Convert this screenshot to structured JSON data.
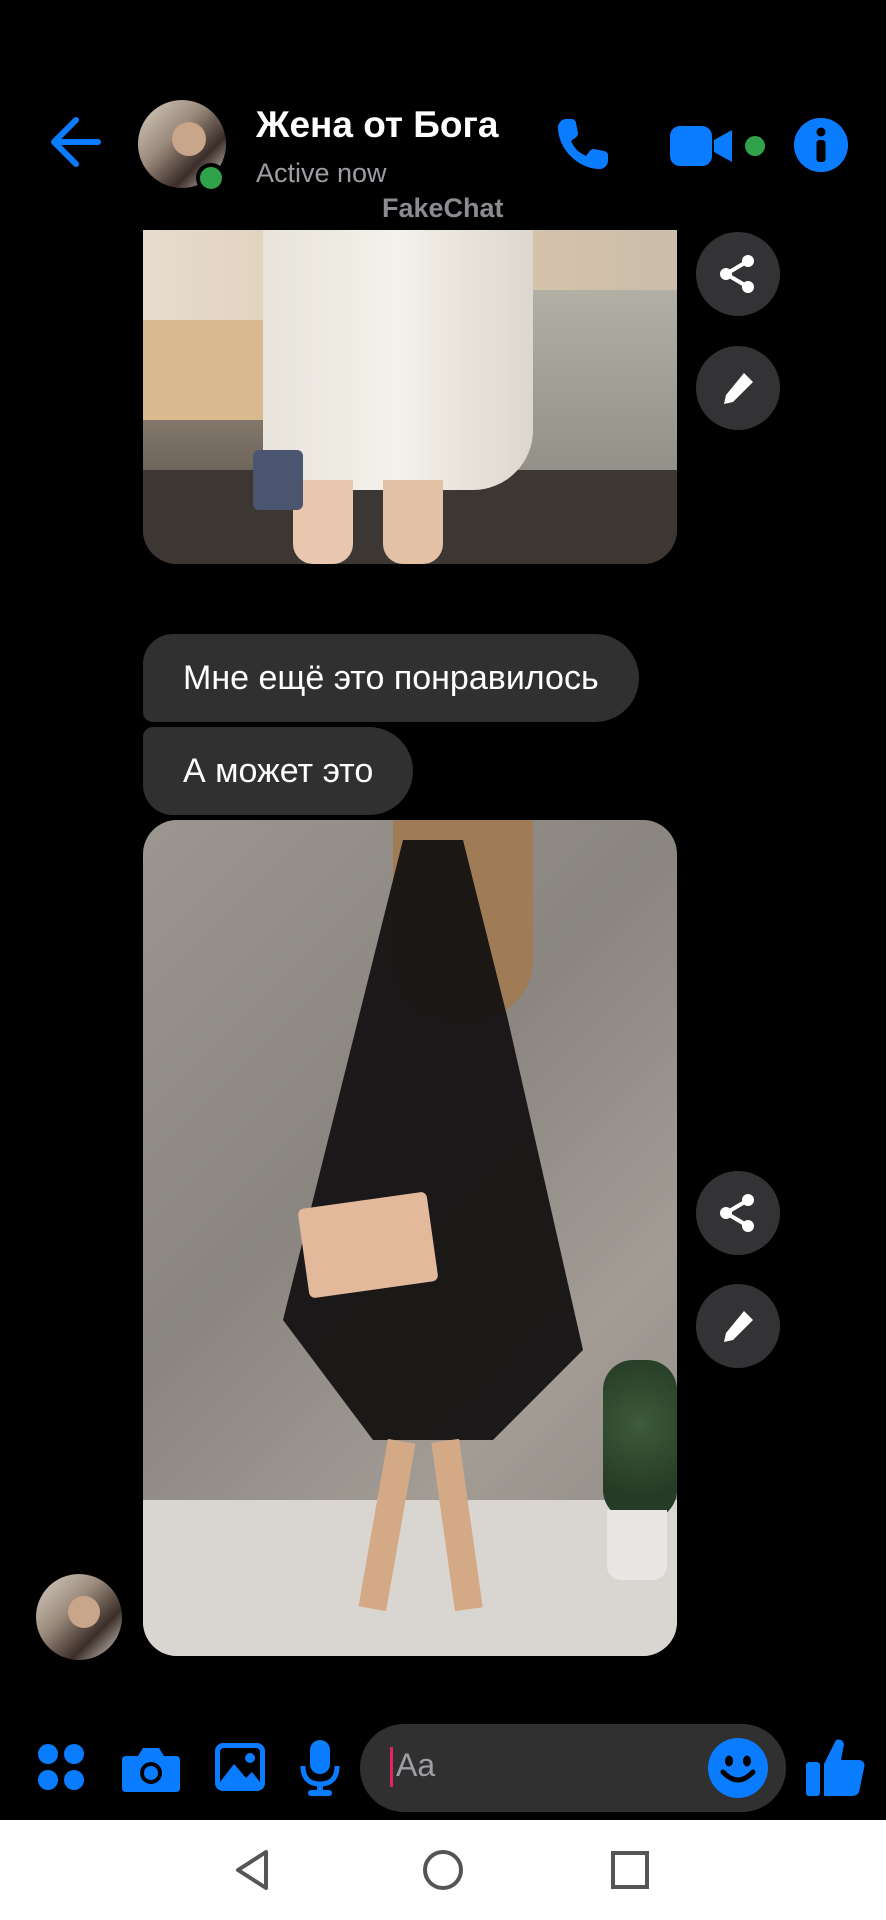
{
  "header": {
    "contact_name": "Жена от Бога",
    "status": "Active now",
    "watermark": "FakeChat",
    "icons": [
      "back-arrow-icon",
      "phone-icon",
      "video-camera-icon",
      "info-icon"
    ]
  },
  "messages": [
    {
      "type": "image",
      "description_icon": "photo-white-shirt-dress"
    },
    {
      "type": "text",
      "text": "Мне ещё это понравилось"
    },
    {
      "type": "text",
      "text": "А может это"
    },
    {
      "type": "image",
      "description_icon": "photo-black-organza-dress"
    }
  ],
  "side_actions": [
    "share-icon",
    "pencil-icon"
  ],
  "composer": {
    "placeholder": "Aa",
    "icons": [
      "apps-grid-icon",
      "camera-icon",
      "gallery-icon",
      "microphone-icon",
      "emoji-icon",
      "thumbs-up-icon"
    ]
  },
  "nav_bar": {
    "icons": [
      "nav-back-icon",
      "nav-home-icon",
      "nav-recents-icon"
    ]
  },
  "colors": {
    "accent": "#0a7cff",
    "online": "#31a24c",
    "bubble": "#303030",
    "background": "#000000"
  }
}
